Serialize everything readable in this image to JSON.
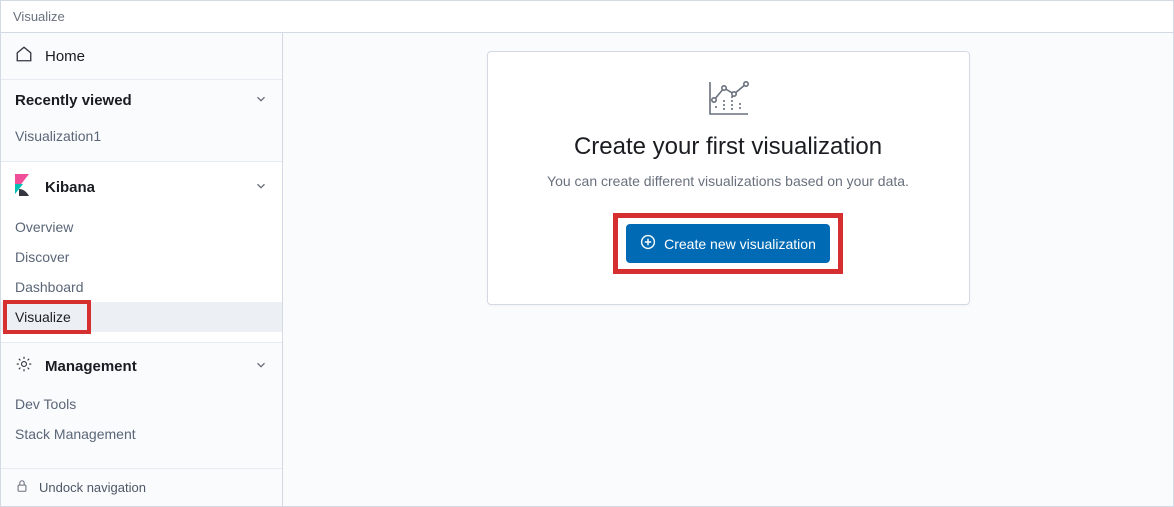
{
  "breadcrumb": "Visualize",
  "sidebar": {
    "home_label": "Home",
    "recently_viewed": {
      "label": "Recently viewed",
      "items": [
        "Visualization1"
      ]
    },
    "kibana": {
      "label": "Kibana",
      "items": [
        {
          "label": "Overview",
          "active": false
        },
        {
          "label": "Discover",
          "active": false
        },
        {
          "label": "Dashboard",
          "active": false
        },
        {
          "label": "Visualize",
          "active": true
        }
      ]
    },
    "management": {
      "label": "Management",
      "items": [
        {
          "label": "Dev Tools"
        },
        {
          "label": "Stack Management"
        }
      ]
    },
    "undock_label": "Undock navigation"
  },
  "main": {
    "card": {
      "title": "Create your first visualization",
      "subtitle": "You can create different visualizations based on your data.",
      "button_label": "Create new visualization"
    }
  }
}
